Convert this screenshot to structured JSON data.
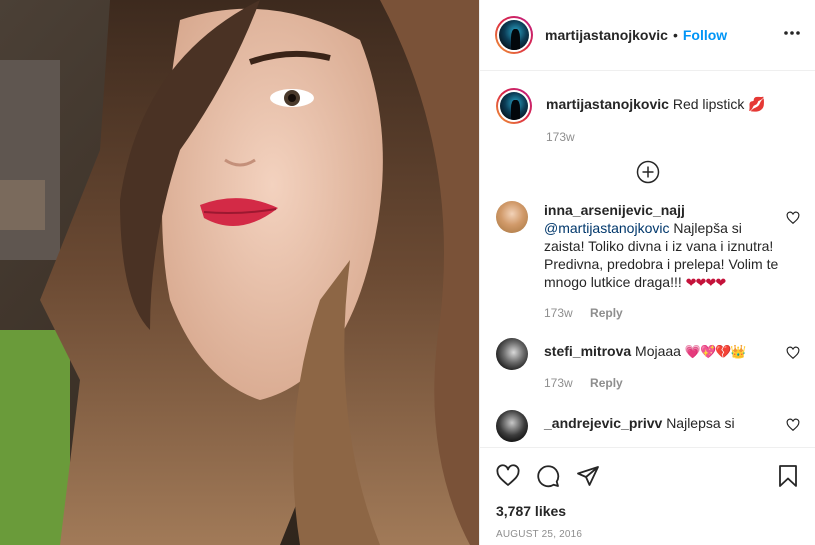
{
  "post": {
    "username": "martijastanojkovic",
    "separator": "•",
    "follow_label": "Follow",
    "more_label": "•••"
  },
  "caption": {
    "username": "martijastanojkovic",
    "text": "Red lipstick 💋",
    "time": "173w"
  },
  "comments": [
    {
      "username": "inna_arsenijevic_najj",
      "mention": "@martijastanojkovic",
      "text": " Najlepša si zaista! Toliko divna i iz vana i iznutra! Predivna, predobra i prelepa! Volim te mnogo lutkice draga!!! ",
      "emoji": "❤❤❤❤",
      "time": "173w",
      "reply_label": "Reply"
    },
    {
      "username": "stefi_mitrova",
      "text": "Mojaaa ",
      "emoji": "💗💖💔👑",
      "time": "173w",
      "reply_label": "Reply"
    },
    {
      "username": "_andrejevic_privv",
      "text": "Najlepsa si"
    }
  ],
  "footer": {
    "likes": "3,787 likes",
    "date": "AUGUST 25, 2016"
  },
  "colors": {
    "follow": "#0095f6",
    "mention": "#00376b",
    "muted": "#8e8e8e"
  }
}
